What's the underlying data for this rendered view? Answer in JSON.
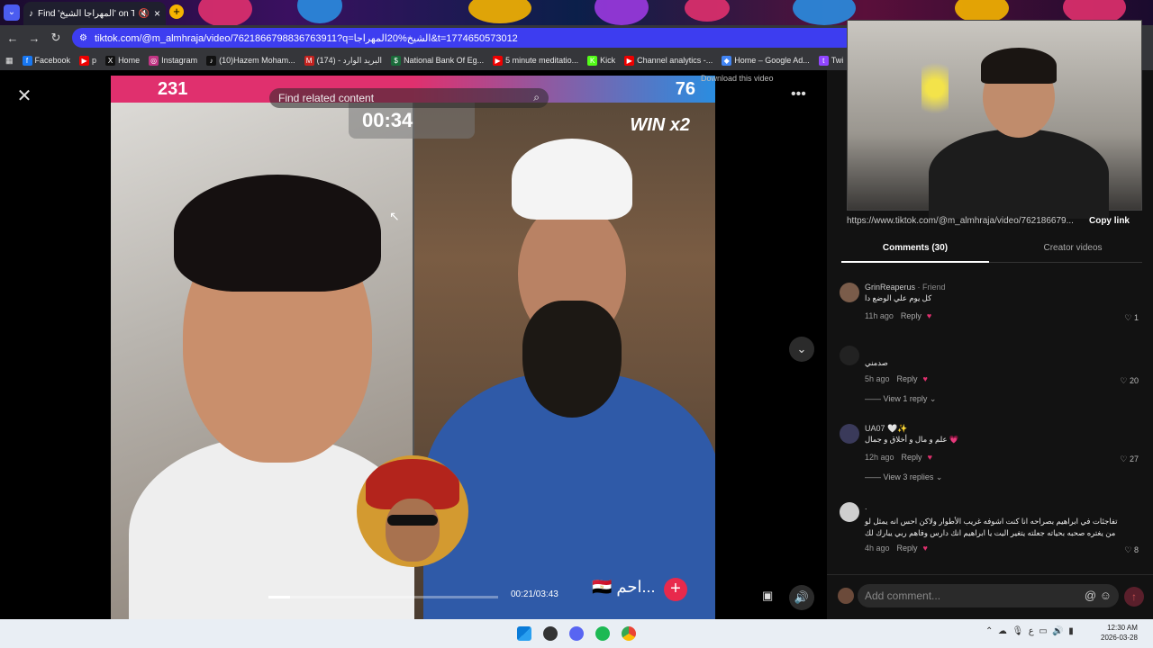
{
  "browser": {
    "tab_title": "Find 'المهراجا الشيخ' on TikT",
    "url": "tiktok.com/@m_almhraja/video/7621866798836763911?q=الشيخ%20المهراجا&t=1774650573012",
    "new_tab": "+"
  },
  "bookmarks": [
    {
      "label": "Facebook",
      "color": "#1877f2",
      "icon": "f"
    },
    {
      "label": "p",
      "color": "#e00",
      "icon": "▶"
    },
    {
      "label": "Home",
      "color": "#111",
      "icon": "X"
    },
    {
      "label": "Instagram",
      "color": "#c13584",
      "icon": "◎"
    },
    {
      "label": "(10)Hazem Moham...",
      "color": "#111",
      "icon": "♪"
    },
    {
      "label": "(174) - البريد الوارد",
      "color": "#c5221f",
      "icon": "M"
    },
    {
      "label": "National Bank Of Eg...",
      "color": "#1a6b3a",
      "icon": "$"
    },
    {
      "label": "5 minute meditatio...",
      "color": "#e00",
      "icon": "▶"
    },
    {
      "label": "Kick",
      "color": "#53fc18",
      "icon": "K"
    },
    {
      "label": "Channel analytics -...",
      "color": "#e00",
      "icon": "▶"
    },
    {
      "label": "Home – Google Ad...",
      "color": "#4285f4",
      "icon": "◆"
    },
    {
      "label": "Twi",
      "color": "#9146ff",
      "icon": "t"
    }
  ],
  "video": {
    "score_left": "231",
    "score_right": "76",
    "timer": "00:34",
    "win": "WIN x2",
    "search_placeholder": "Find related content",
    "download_hint": "Download this video",
    "time": "00:21/03:43",
    "progress": 0.094,
    "name_tag": "🇪🇬 احم..."
  },
  "side": {
    "link": "https://www.tiktok.com/@m_almhraja/video/762186679...",
    "copy_link": "Copy link",
    "tab_comments": "Comments (30)",
    "tab_creator": "Creator videos",
    "add_comment": "Add comment...",
    "comments": [
      {
        "user": "GrinReaperus",
        "badge": " · Friend",
        "text": "كل يوم علي الوضع دا",
        "time": "11h ago",
        "reply": "Reply",
        "likes": "1"
      },
      {
        "user": "",
        "badge": "",
        "text": "صدمني",
        "time": "5h ago",
        "reply": "Reply",
        "likes": "20",
        "view": "View 1 reply"
      },
      {
        "user": "UA07",
        "badge": " 🤍✨",
        "text": "علم و مال و أخلاق و جمال 💗",
        "time": "12h ago",
        "reply": "Reply",
        "likes": "27",
        "view": "View 3 replies"
      },
      {
        "user": ".",
        "badge": "",
        "text": "تفاجئات في ابراهيم بصراحه انا كنت اشوفه غريب الأطوار ولاكن احس انه يمثل لو",
        "text2": "من يغتره صحبه بحياته جعلته يتغير اليت يا ابراهيم انك دارس وفاهم ربي يبارك لك",
        "time": "4h ago",
        "reply": "Reply",
        "likes": "8"
      }
    ]
  },
  "taskbar": {
    "time": "12:30 AM",
    "date": "2026-03-28",
    "lang": "ع"
  }
}
